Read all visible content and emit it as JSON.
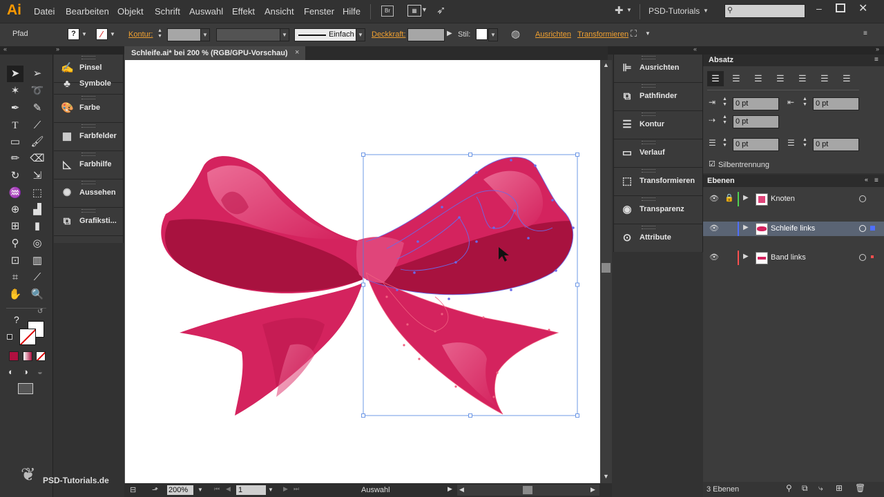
{
  "app": {
    "logo": "Ai",
    "workspace": "PSD-Tutorials",
    "brand_watermark": "PSD-Tutorials.de"
  },
  "menu": [
    "Datei",
    "Bearbeiten",
    "Objekt",
    "Schrift",
    "Auswahl",
    "Effekt",
    "Ansicht",
    "Fenster",
    "Hilfe"
  ],
  "menu_br_button": "Br",
  "control": {
    "selection_type": "Pfad",
    "kontur_label": "Kontur:",
    "stroke_style": "Einfach",
    "opacity_label": "Deckkraft:",
    "style_label": "Stil:",
    "align_link": "Ausrichten",
    "transform_link": "Transformieren"
  },
  "document_tab": {
    "title": "Schleife.ai* bei 200 % (RGB/GPU-Vorschau)",
    "close": "×"
  },
  "left_panels": [
    "Pinsel",
    "Symbole",
    "Farbe",
    "Farbfelder",
    "Farbhilfe",
    "Aussehen",
    "Grafiksti..."
  ],
  "right_panels": [
    "Ausrichten",
    "Pathfinder",
    "Kontur",
    "Verlauf",
    "Transformieren",
    "Transparenz",
    "Attribute"
  ],
  "absatz": {
    "title": "Absatz",
    "indent_left": "0 pt",
    "indent_right": "0 pt",
    "first_line": "0 pt",
    "space_before": "0 pt",
    "space_after": "0 pt",
    "hyphenation_label": "Silbentrennung",
    "hyphenation_checked": true
  },
  "layers": {
    "title": "Ebenen",
    "items": [
      {
        "name": "Knoten",
        "color": "#4fd14f",
        "locked": true,
        "selected": false
      },
      {
        "name": "Schleife links",
        "color": "#4f6fff",
        "locked": false,
        "selected": true
      },
      {
        "name": "Band links",
        "color": "#ff4f4f",
        "locked": false,
        "selected": false
      }
    ],
    "count": "3 Ebenen"
  },
  "statusbar": {
    "zoom": "200%",
    "page": "1",
    "tool": "Auswahl"
  },
  "tool_help": "?",
  "colors": {
    "bow": "#d4235e",
    "bow_dark": "#a8123f",
    "bow_light": "#ec6a94",
    "accent_orange": "#f0a030"
  }
}
